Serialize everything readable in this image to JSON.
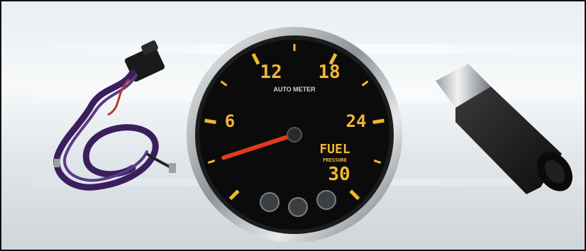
{
  "scene": {
    "objects": [
      "wiring-harness",
      "fuel-pressure-gauge",
      "pressure-sender"
    ]
  },
  "gauge": {
    "scale_labels": [
      "6",
      "12",
      "18",
      "24",
      "30"
    ],
    "brand_text": "AUTO METER",
    "unit_line1": "FUEL",
    "unit_line2": "PRESSURE",
    "needle_reading": 3,
    "needle_color": "#e23b1b",
    "marking_color": "#f2b632",
    "face_color": "#0b0b0b",
    "bezel_color": "#c9ced2"
  }
}
